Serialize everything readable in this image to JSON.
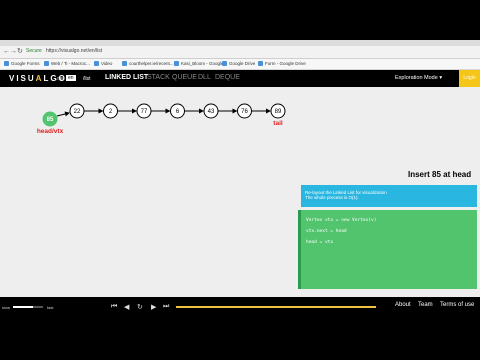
{
  "browser": {
    "secure_label": "Secure",
    "url": "https://visualgo.net/en/list",
    "bookmarks": [
      "Google Forms",
      "Web / Ti - Macroc...",
      "Video",
      "courthelper.ie/recent...",
      "Kasi_Bloom - Google...",
      "Google Drive",
      "Form - Google Drive"
    ]
  },
  "app": {
    "logo_prefix": "VISU",
    "logo_accent": "A",
    "logo_suffix": "LGO",
    "logo_sub": ".net",
    "lang": "en",
    "path": "/list",
    "nav": [
      "LINKED LIST",
      "STACK",
      "QUEUE",
      "DLL",
      "DEQUE"
    ],
    "mode_label": "Exploration Mode",
    "login_label": "Login"
  },
  "list": {
    "new_node": "85",
    "head_label": "head/vtx",
    "tail_label": "tail",
    "nodes": [
      "22",
      "2",
      "77",
      "6",
      "43",
      "76",
      "89"
    ]
  },
  "panel": {
    "operation_title": "Insert 85 at head",
    "status_lines": [
      "Re-layout the Linked List for visualization",
      "The whole process is O(1)."
    ],
    "code_lines": [
      "Vertex vtx = new Vertex(v)",
      "vtx.next = head",
      "head = vtx"
    ]
  },
  "controls": {
    "speed_slow": "slow",
    "speed_fast": "fast",
    "speed_value": 0.65,
    "progress_value": 1.0,
    "footer_links": [
      "About",
      "Team",
      "Terms of use"
    ]
  },
  "colors": {
    "new_node": "#52c46e",
    "tail_label": "#e02020",
    "status_bg": "#29b6e0",
    "code_bg": "#52c46e",
    "accent": "#f0c040"
  }
}
